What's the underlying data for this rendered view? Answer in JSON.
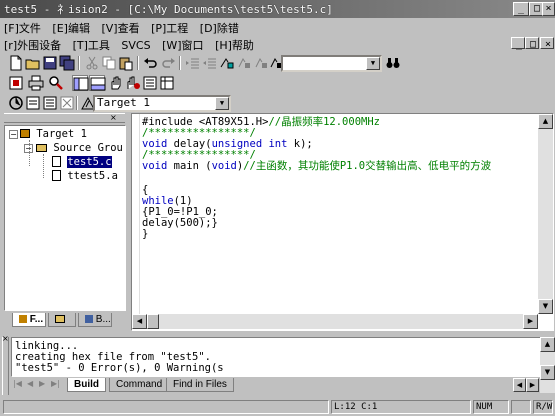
{
  "window": {
    "title": "test5  - 礻ision2 - [C:\\My Documents\\test5\\test5.c]",
    "controls": [
      "_",
      "□",
      "×"
    ]
  },
  "menu": {
    "row1": [
      "[F]文件",
      "[E]编辑",
      "[V]查看",
      "[P]工程",
      "[D]除错"
    ],
    "row2": [
      "[r]外围设备",
      "[T]工具",
      "SVCS",
      "[W]窗口",
      "[H]帮助"
    ]
  },
  "toolbar": {
    "find_combo_value": "",
    "target_combo_value": "Target 1"
  },
  "workspace": {
    "tree": {
      "root": "Target 1",
      "group": "Source Grou",
      "files": [
        "test5.c",
        "ttest5.a"
      ]
    },
    "tabs": [
      "F...",
      "",
      "B..."
    ]
  },
  "editor": {
    "lines": [
      {
        "code": "#include <AT89X51.H>",
        "comment": "//晶振频率12.000MHz"
      },
      {
        "code": "",
        "comment": "/****************/"
      },
      {
        "code": "void delay(unsigned int k);",
        "comment": ""
      },
      {
        "code": "",
        "comment": "/****************/"
      },
      {
        "code": "void main (void)",
        "comment": "//主函数，其功能使P1.0交替输出高、低电平的方波"
      },
      {
        "code": "",
        "comment": ""
      },
      {
        "code": "{",
        "comment": ""
      },
      {
        "code": "while(1)",
        "comment": ""
      },
      {
        "code": "{P1_0=!P1_0;",
        "comment": ""
      },
      {
        "code": "delay(500);}",
        "comment": ""
      },
      {
        "code": "}",
        "comment": ""
      }
    ]
  },
  "output": {
    "lines": [
      "linking...",
      "creating hex file from \"test5\".",
      "\"test5\" - 0 Error(s), 0 Warning(s"
    ],
    "tabs": [
      "Build",
      "Command",
      "Find in Files"
    ]
  },
  "status": {
    "position": "L:12 C:1",
    "num": "NUM",
    "rw": "R/W"
  }
}
